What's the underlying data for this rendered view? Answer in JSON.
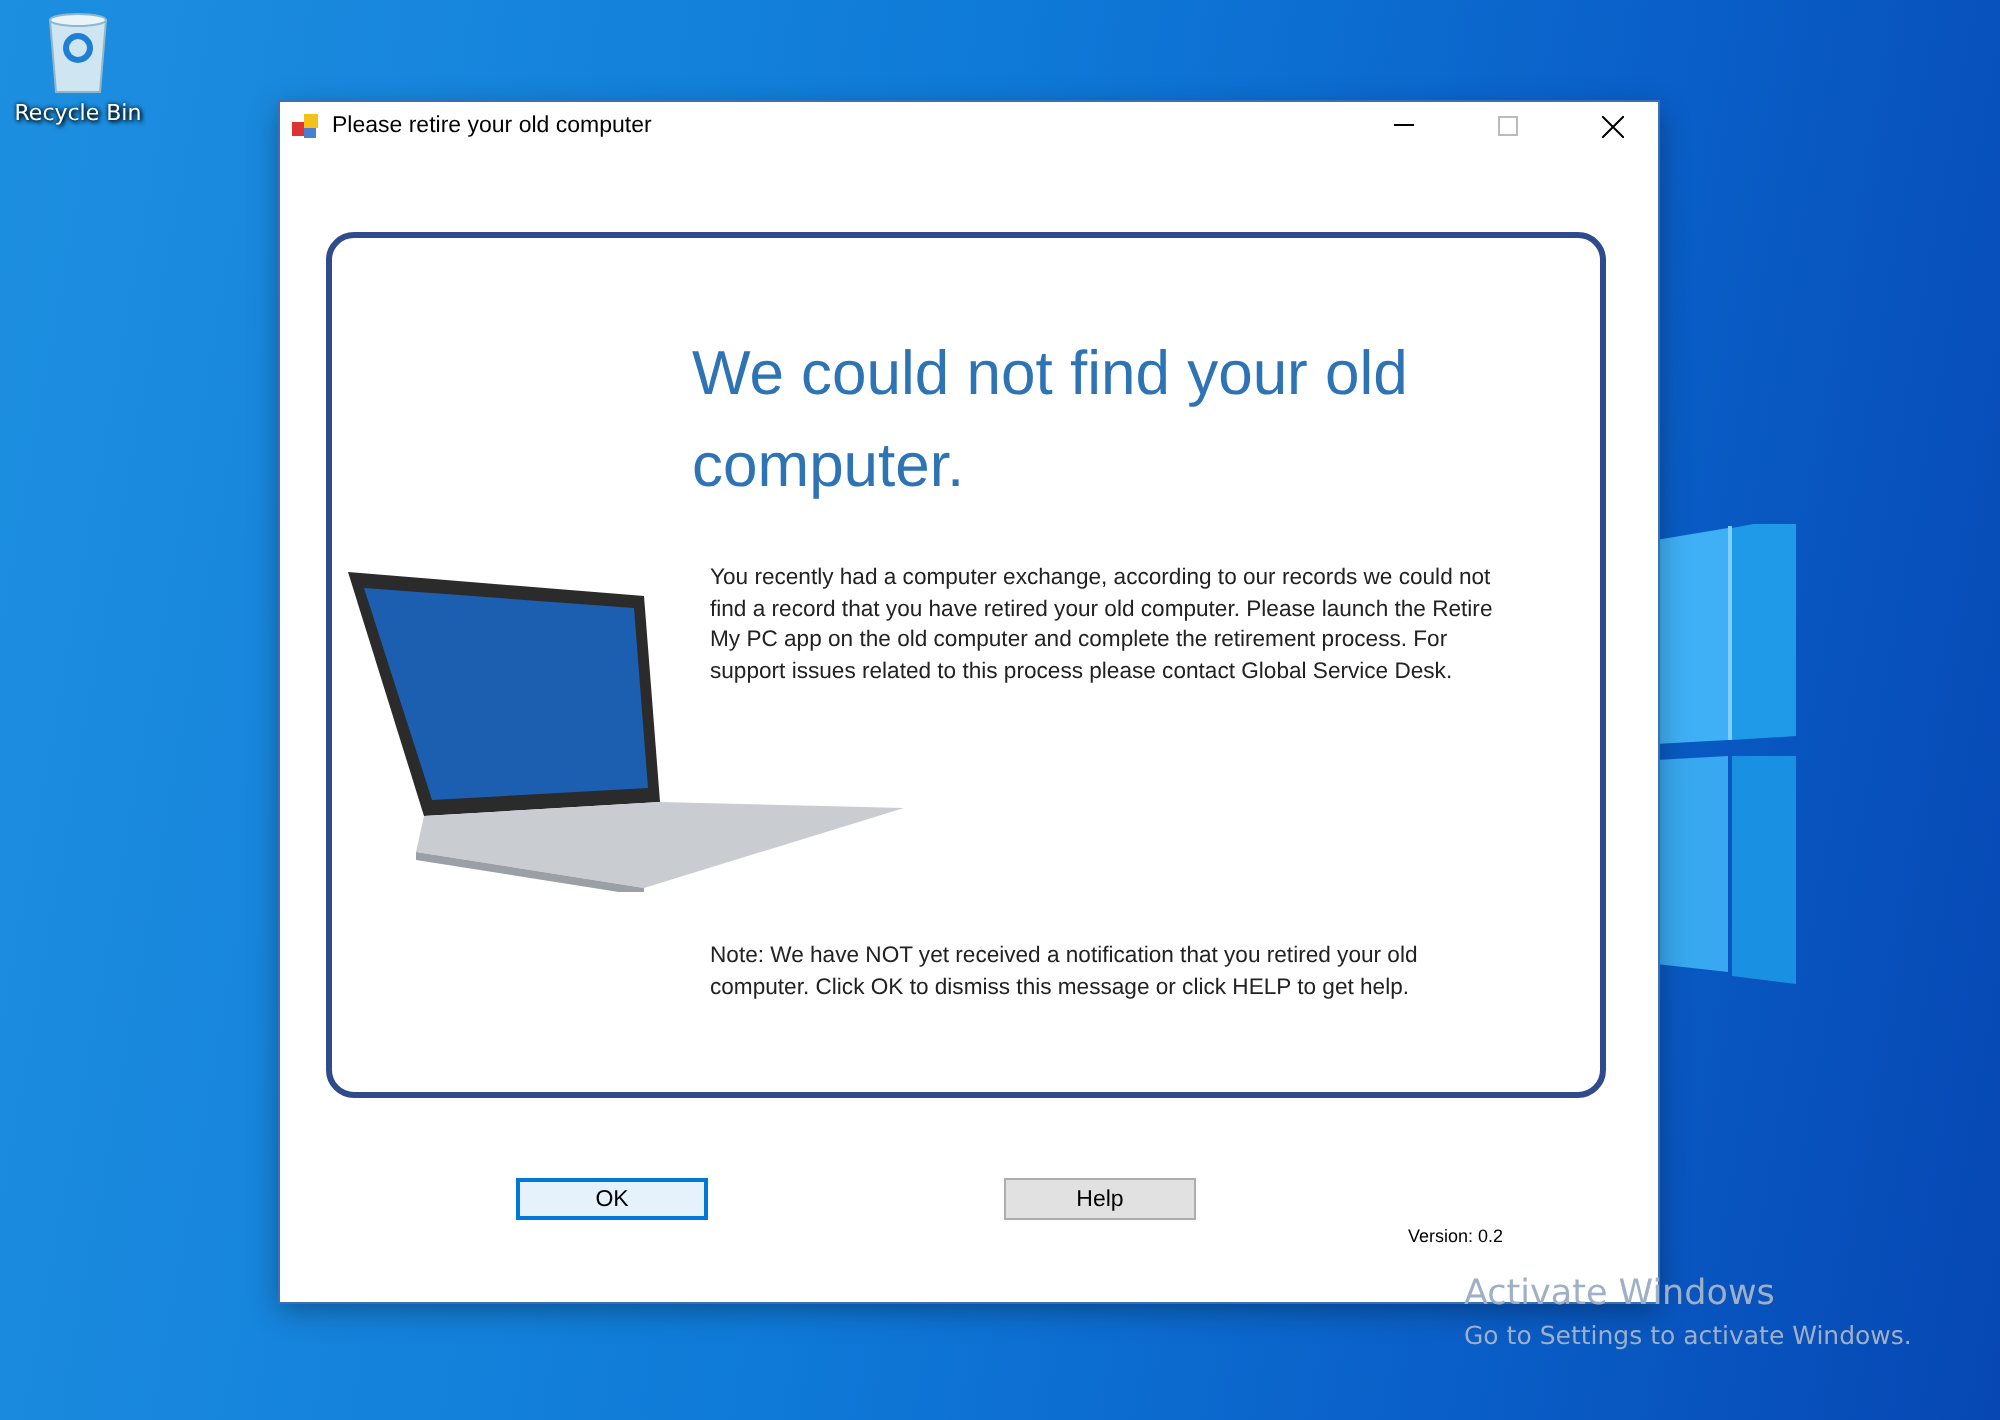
{
  "desktop_icons": [
    {
      "label": "Recycle Bin"
    }
  ],
  "window": {
    "title": "Please retire your old computer"
  },
  "message": {
    "heading": "We could not find your old computer.",
    "body": "You recently had a computer exchange, according to our records we could not find a record that you have retired your old computer. Please launch the Retire My PC app on the old computer and complete the retirement process. For support issues related to this process please contact Global Service Desk.",
    "note": "Note: We have NOT yet received a notification that you retired your old computer. Click OK to dismiss this message or click HELP to get help."
  },
  "buttons": [
    {
      "label": "OK",
      "default": true
    },
    {
      "label": "Help",
      "default": false
    }
  ],
  "version": "Version: 0.2",
  "activation": {
    "title": "Activate Windows",
    "subtitle": "Go to Settings to activate Windows."
  }
}
